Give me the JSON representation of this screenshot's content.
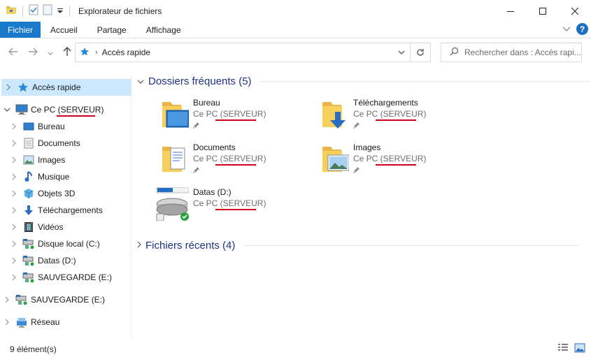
{
  "window": {
    "title": "Explorateur de fichiers"
  },
  "ribbon": {
    "file_tab": "Fichier",
    "tabs": [
      "Accueil",
      "Partage",
      "Affichage"
    ],
    "help": "?"
  },
  "address": {
    "path": "Accès rapide"
  },
  "search": {
    "placeholder": "Rechercher dans : Accès rapi..."
  },
  "nav": {
    "quick_access": "Accès rapide",
    "this_pc": "Ce PC (SERVEUR)",
    "items": [
      "Bureau",
      "Documents",
      "Images",
      "Musique",
      "Objets 3D",
      "Téléchargements",
      "Vidéos",
      "Disque local (C:)",
      "Datas (D:)",
      "SAUVEGARDE (E:)"
    ],
    "sauvegarde": "SAUVEGARDE (E:)",
    "network": "Réseau"
  },
  "content": {
    "frequent_label": "Dossiers fréquents (5)",
    "recent_label": "Fichiers récents (4)",
    "tiles": [
      {
        "name": "Bureau",
        "location": "Ce PC (SERVEUR)"
      },
      {
        "name": "Téléchargements",
        "location": "Ce PC (SERVEUR)"
      },
      {
        "name": "Documents",
        "location": "Ce PC (SERVEUR)"
      },
      {
        "name": "Images",
        "location": "Ce PC (SERVEUR)"
      },
      {
        "name": "Datas (D:)",
        "location": "Ce PC (SERVEUR)"
      }
    ]
  },
  "status": {
    "count": "9 élément(s)"
  },
  "colors": {
    "accent": "#1979ca",
    "selection": "#cce8ff",
    "group_header": "#1e3287",
    "annotation": "#d0021b"
  }
}
